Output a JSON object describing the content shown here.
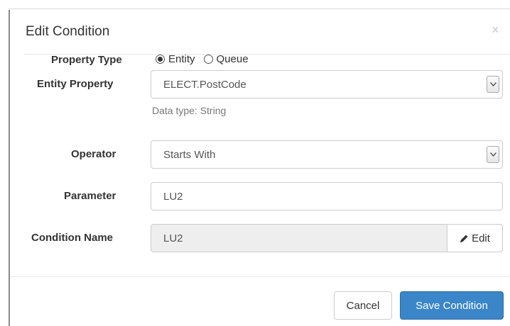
{
  "dialog": {
    "title": "Edit Condition",
    "close_symbol": "×"
  },
  "form": {
    "property_type": {
      "label": "Property Type",
      "options": [
        {
          "label": "Entity",
          "checked": true
        },
        {
          "label": "Queue",
          "checked": false
        }
      ]
    },
    "entity_property": {
      "label": "Entity Property",
      "value": "ELECT.PostCode",
      "hint": "Data type: String"
    },
    "operator": {
      "label": "Operator",
      "value": "Starts With"
    },
    "parameter": {
      "label": "Parameter",
      "value": "LU2"
    },
    "condition_name": {
      "label": "Condition Name",
      "value": "LU2",
      "edit_label": "Edit"
    }
  },
  "footer": {
    "cancel_label": "Cancel",
    "save_label": "Save Condition"
  },
  "colors": {
    "primary": "#3a86c8",
    "readonly_bg": "#eeeeee"
  },
  "icons": {
    "close": "close-icon",
    "select": "chevron-down-icon",
    "edit": "pencil-icon"
  }
}
